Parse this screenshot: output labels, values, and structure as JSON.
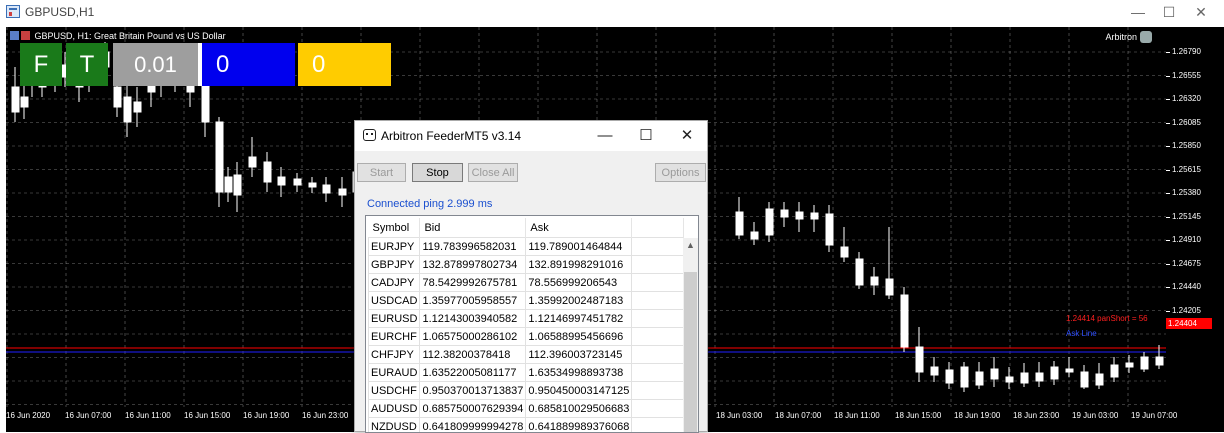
{
  "window": {
    "title": "GBPUSD,H1",
    "minimize": "—",
    "maximize": "☐",
    "close": "✕"
  },
  "chart": {
    "info": "GBPUSD, H1:  Great Britain Pound vs US Dollar",
    "robot_name": "Arbitron",
    "price_labels": [
      "1.26790",
      "1.26555",
      "1.26320",
      "1.26085",
      "1.25850",
      "1.25615",
      "1.25380",
      "1.25145",
      "1.24910",
      "1.24675",
      "1.24440",
      "1.24205"
    ],
    "time_labels": [
      "16 Jun 2020",
      "16 Jun 07:00",
      "16 Jun 11:00",
      "16 Jun 15:00",
      "16 Jun 19:00",
      "16 Jun 23:00",
      "18 Jun 03:00",
      "18 Jun 07:00",
      "18 Jun 11:00",
      "18 Jun 15:00",
      "18 Jun 19:00",
      "18 Jun 23:00",
      "19 Jun 03:00",
      "19 Jun 07:00"
    ],
    "red_line_label": "1.24414 panShort = 56",
    "blue_line_label": "Ask Line",
    "red_price_tag": "1.24404",
    "colors": {
      "background": "#000000",
      "candle_bull": "#000000",
      "candle_bear": "#ffffff",
      "grid": "#c0c0c0",
      "red_line": "#ff0000",
      "blue_line": "#2020ff"
    }
  },
  "panel": {
    "f_button": "F",
    "t_button": "T",
    "lot": "0.01",
    "blue_value": "0",
    "yellow_value": "0",
    "colors": {
      "green": "#1a7a1a",
      "gray": "#9e9e9e",
      "blue": "#0000ee",
      "yellow": "#ffcc00"
    }
  },
  "dialog": {
    "title": "Arbitron FeederMT5 v3.14",
    "buttons": {
      "start": "Start",
      "stop": "Stop",
      "close_all": "Close All",
      "options": "Options"
    },
    "status": "Connected  ping  2.999  ms",
    "columns": [
      "Symbol",
      "Bid",
      "Ask"
    ],
    "rows": [
      [
        "EURJPY",
        "119.783996582031",
        "119.789001464844"
      ],
      [
        "GBPJPY",
        "132.878997802734",
        "132.891998291016"
      ],
      [
        "CADJPY",
        "78.5429992675781",
        "78.556999206543"
      ],
      [
        "USDCAD",
        "1.35977005958557",
        "1.35992002487183"
      ],
      [
        "EURUSD",
        "1.12143003940582",
        "1.12146997451782"
      ],
      [
        "EURCHF",
        "1.06575000286102",
        "1.06588995456696"
      ],
      [
        "CHFJPY",
        "112.38200378418",
        "112.396003723145"
      ],
      [
        "EURAUD",
        "1.63522005081177",
        "1.63534998893738"
      ],
      [
        "USDCHF",
        "0.950370013713837",
        "0.950450003147125"
      ],
      [
        "AUDUSD",
        "0.685750007629394",
        "0.685810029506683"
      ],
      [
        "NZDUSD",
        "0.641809999994278",
        "0.641889989376068"
      ]
    ]
  }
}
